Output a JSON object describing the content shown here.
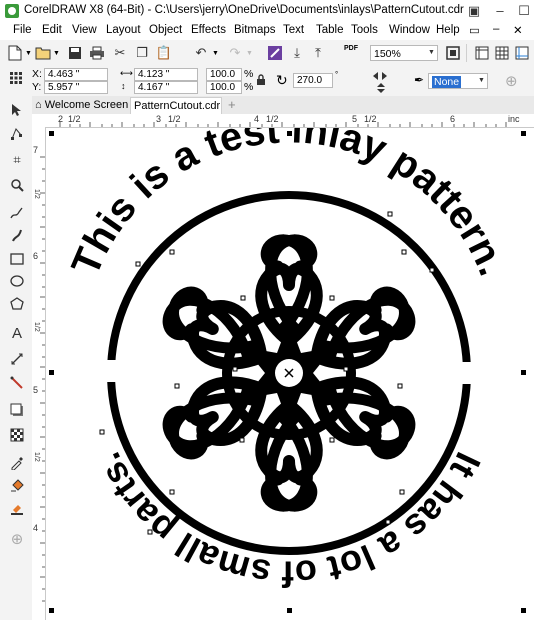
{
  "titlebar": {
    "title": "CorelDRAW X8 (64-Bit) - C:\\Users\\jerry\\OneDrive\\Documents\\inlays\\PatternCutout.cdr",
    "restore_glyph": "▣",
    "minimize_glyph": "–",
    "maximize_glyph": "☐"
  },
  "menu": {
    "items": [
      "File",
      "Edit",
      "View",
      "Layout",
      "Object",
      "Effects",
      "Bitmaps",
      "Text",
      "Table",
      "Tools",
      "Window",
      "Help"
    ]
  },
  "toolbar": {
    "zoom_value": "150%",
    "pdf_label": "PDF"
  },
  "propbar": {
    "x_label": "X:",
    "x_value": "4.463 \"",
    "y_label": "Y:",
    "y_value": "5.957 \"",
    "width_value": "4.123 \"",
    "height_value": "4.167 \"",
    "scale_x": "100.0",
    "scale_y": "100.0",
    "percent": "%",
    "rotation": "270.0",
    "outline_value": "None"
  },
  "tabs": {
    "welcome": "Welcome Screen",
    "document": "PatternCutout.cdr"
  },
  "hruler": {
    "labels": [
      "2",
      "1/2",
      "3",
      "1/2",
      "4",
      "1/2",
      "5",
      "1/2",
      "6",
      "inc"
    ]
  },
  "vruler": {
    "labels": [
      "7",
      "1/2",
      "6",
      "1/2",
      "5",
      "1/2",
      "4"
    ]
  },
  "canvas": {
    "text_left": "This is a test inlay pattern.",
    "text_right": "It has a lot of small parts.",
    "accent_color": "#000000"
  }
}
